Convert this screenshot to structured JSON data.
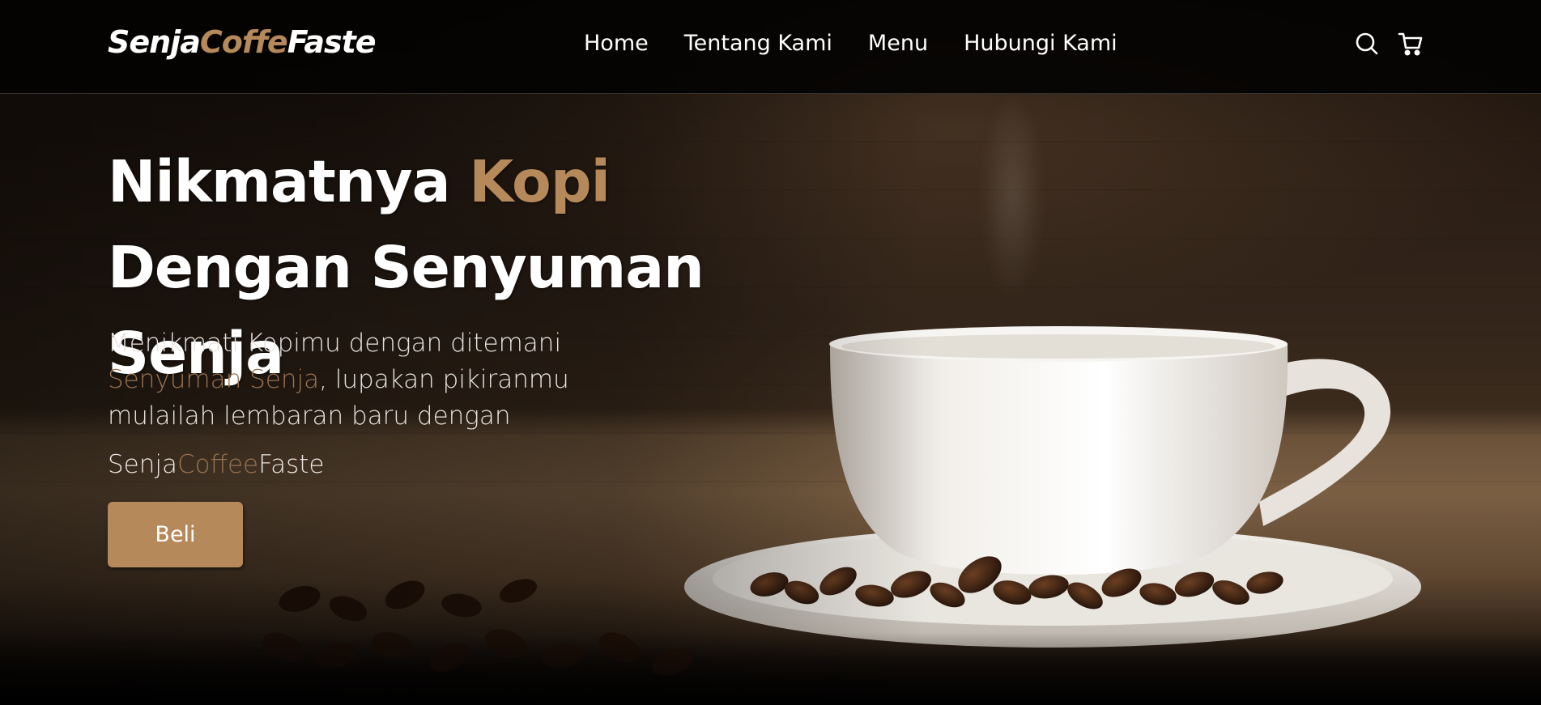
{
  "colors": {
    "accent": "#b6895b",
    "accent_muted": "#9a7350",
    "navbar_bg": "#040302",
    "text_primary": "#ffffff"
  },
  "navbar": {
    "logo": {
      "part1": "Senja",
      "part2": "Coffe",
      "part3": "Faste"
    },
    "links": [
      {
        "label": "Home"
      },
      {
        "label": "Tentang Kami"
      },
      {
        "label": "Menu"
      },
      {
        "label": "Hubungi Kami"
      }
    ],
    "icons": [
      "search-icon",
      "shopping-cart-icon"
    ]
  },
  "hero": {
    "title": {
      "part1": "Nikmatnya ",
      "accent": "Kopi",
      "part2": " Dengan Senyuman Senja"
    },
    "description": {
      "line1": "Menikmati Kopimu dengan ditemani ",
      "accent": "Senyuman Senja",
      "line2": ", lupakan pikiranmu mulailah lembaran baru dengan"
    },
    "brand": {
      "part1": "Senja",
      "part2": "Coffee",
      "part3": "Faste"
    },
    "button_label": "Beli"
  }
}
